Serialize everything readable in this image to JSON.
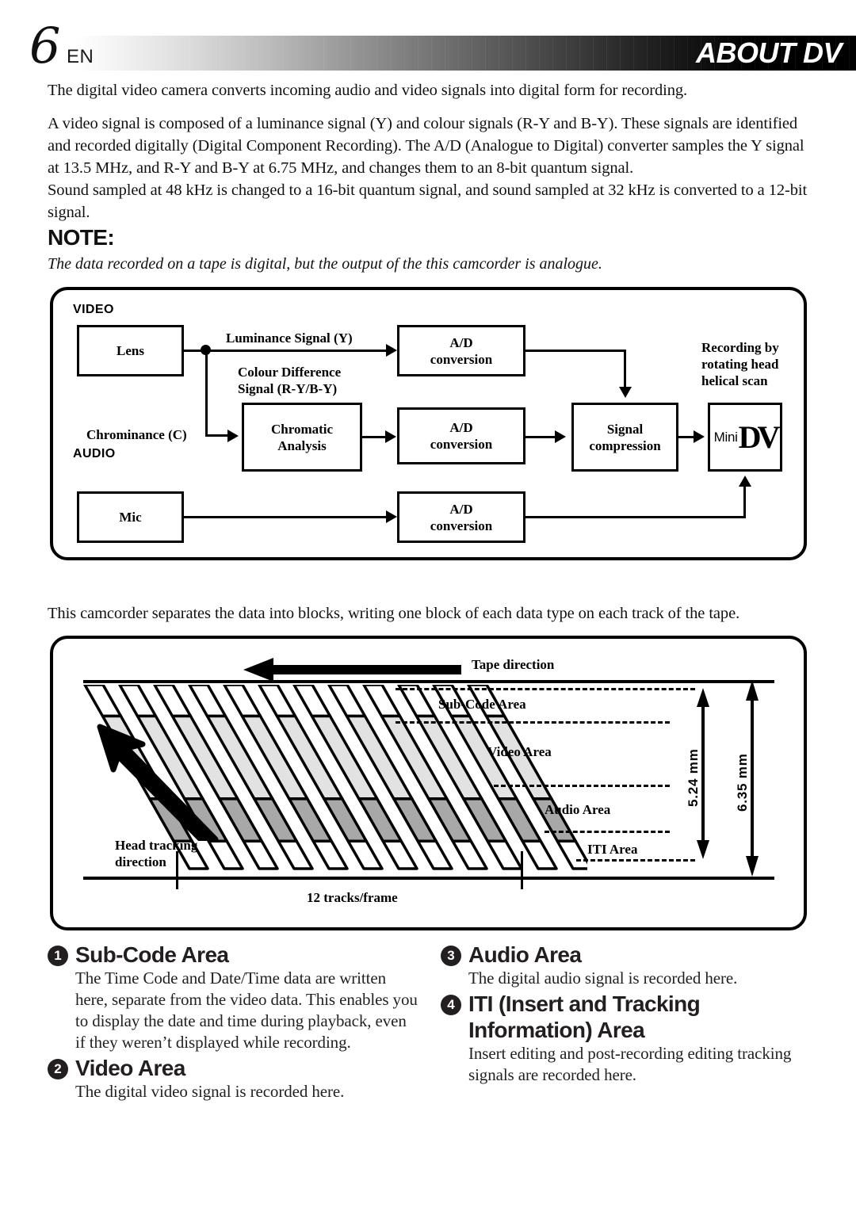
{
  "header": {
    "page_number": "6",
    "language_code": "EN",
    "title": "ABOUT DV"
  },
  "intro": {
    "paragraph_1": "The digital video camera converts incoming audio and video signals into digital form for recording.",
    "paragraph_2": "A video signal is composed of a luminance signal (Y) and colour signals (R-Y and B-Y). These signals are identified and recorded digitally (Digital Component Recording). The A/D (Analogue to Digital) converter samples the Y signal at 13.5 MHz, and R-Y and B-Y at 6.75 MHz, and changes them to an 8-bit quantum signal.",
    "paragraph_3": "Sound sampled at 48 kHz is changed to a 16-bit quantum signal, and sound sampled at 32 kHz is converted to a 12-bit signal."
  },
  "note": {
    "heading": "NOTE:",
    "text": "The data recorded on a tape is digital, but the output of the this camcorder is analogue."
  },
  "signal_diagram": {
    "section_video": "VIDEO",
    "section_audio": "AUDIO",
    "box_lens": "Lens",
    "box_chromatic": "Chromatic\nAnalysis",
    "box_mic": "Mic",
    "box_ad_1": "A/D\nconversion",
    "box_ad_2": "A/D\nconversion",
    "box_ad_3": "A/D\nconversion",
    "box_compression": "Signal\ncompression",
    "label_luminance": "Luminance Signal (Y)",
    "label_colour_difference": "Colour Difference\nSignal (R-Y/B-Y)",
    "label_chrominance": "Chrominance (C)",
    "label_recording": "Recording by\nrotating head\nhelical scan",
    "logo_mini": "Mini",
    "logo_dv": "DV"
  },
  "tape_intro": "This camcorder separates the data into blocks, writing one block of each data type on each track of the tape.",
  "tape_diagram": {
    "tape_direction": "Tape direction",
    "head_tracking": "Head tracking\ndirection",
    "tracks_per_frame": "12 tracks/frame",
    "areas": [
      "Sub-Code Area",
      "Video Area",
      "Audio Area",
      "ITI Area"
    ],
    "dimension_inner": "5.24 mm",
    "dimension_outer": "6.35 mm",
    "track_count": 12,
    "colors": {
      "video_band": "#e2e2e2",
      "audio_band": "#a8a8a8",
      "subcode_band": "#ffffff",
      "iti_band": "#ffffff",
      "outline": "#000000"
    }
  },
  "area_descriptions": [
    {
      "number": "1",
      "title": "Sub-Code Area",
      "body": "The Time Code and Date/Time data are written here, separate from the video data. This enables you to display the date and time during playback, even if they weren’t displayed while recording."
    },
    {
      "number": "2",
      "title": "Video Area",
      "body": "The digital video signal is recorded here."
    },
    {
      "number": "3",
      "title": "Audio Area",
      "body": "The digital audio signal is recorded here."
    },
    {
      "number": "4",
      "title": "ITI (Insert and Tracking Information) Area",
      "body": "Insert editing and post-recording editing tracking signals are recorded here."
    }
  ]
}
